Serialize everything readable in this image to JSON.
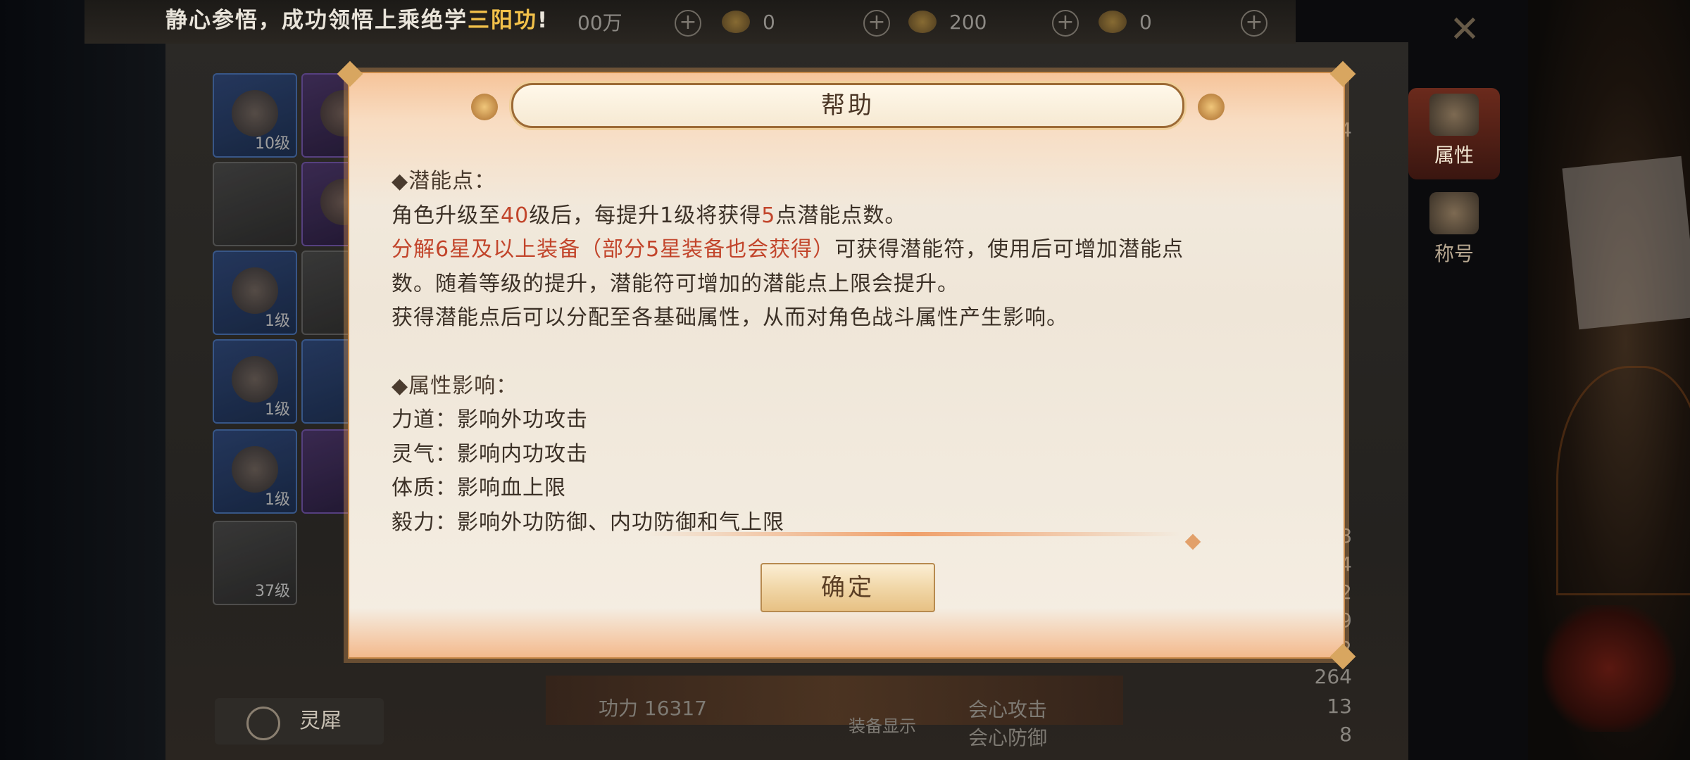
{
  "marquee": {
    "prefix": "静心参悟，成功领悟上乘绝学",
    "highlight": "三阳功",
    "suffix": "!"
  },
  "currencies": [
    {
      "icon": "silver-coin-icon",
      "value": "00万"
    },
    {
      "icon": "gold-ingot-icon",
      "value": "0"
    },
    {
      "icon": "yuanbao-icon",
      "value": "200"
    },
    {
      "icon": "bound-yuanbao-icon",
      "value": "0"
    }
  ],
  "equipment_slots": [
    {
      "level": "10级"
    },
    {
      "level": ""
    },
    {
      "level": "1级"
    },
    {
      "level": "1级"
    },
    {
      "level": "1级"
    },
    {
      "level": "37级"
    }
  ],
  "side_tabs": [
    {
      "label": "属性",
      "icon": "attribute-icon",
      "active": true
    },
    {
      "label": "称号",
      "icon": "title-emblem-icon",
      "active": false
    }
  ],
  "right_stats": [
    "24",
    "8",
    "4",
    "2",
    "9",
    "2",
    "264",
    "13",
    "8"
  ],
  "bottom": {
    "lingxi_label": "灵犀",
    "power_label": "功力 16317",
    "equip_display_label": "装备显示",
    "crit_attack_label": "会心攻击",
    "crit_defense_label": "会心防御"
  },
  "dialog": {
    "title": "帮助",
    "section1_heading": "◆潜能点：",
    "line1_a": "角色升级至",
    "line1_b": "40",
    "line1_c": "级后，每提升1级将获得",
    "line1_d": "5",
    "line1_e": "点潜能点数。",
    "line2_a": "分解",
    "line2_b": "6星及以上装备（部分5星装备也会获得）",
    "line2_c": "可获得潜能符，使用后可增加潜能点",
    "line3": "数。随着等级的提升，潜能符可增加的潜能点上限会提升。",
    "line4": "获得潜能点后可以分配至各基础属性，从而对角色战斗属性产生影响。",
    "section2_heading": "◆属性影响：",
    "attr1": "力道：影响外功攻击",
    "attr2": "灵气：影响内功攻击",
    "attr3": "体质：影响血上限",
    "attr4": "毅力：影响外功防御、内功防御和气上限",
    "confirm_label": "确定"
  },
  "colors": {
    "highlight_red": "#c2452b",
    "marquee_gold": "#f2c14a",
    "dialog_bg": "#f4ece0",
    "dialog_border": "#c98a4a"
  }
}
